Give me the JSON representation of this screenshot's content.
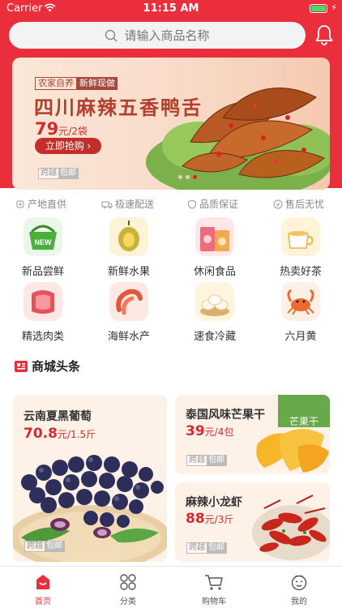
{
  "status_bar": {
    "carrier": "Carrier",
    "time": "11:15 AM"
  },
  "search": {
    "placeholder": "请输入商品名称"
  },
  "banner": {
    "tag1": "农家自养",
    "tag2": "新鲜现做",
    "title": "四川麻辣五香鸭舌",
    "price": "79",
    "price_unit": "元/2袋",
    "buy_button": "立即抢购 ›",
    "badge_a": "跨越",
    "badge_b": "包邮",
    "page_count": 3,
    "active_page": 3
  },
  "features": [
    "产地直供",
    "极速配送",
    "品质保证",
    "售后无忧"
  ],
  "categories": [
    {
      "label": "新品尝鲜",
      "icon": "new-basket-icon"
    },
    {
      "label": "新鲜水果",
      "icon": "durian-icon"
    },
    {
      "label": "休闲食品",
      "icon": "snacks-icon"
    },
    {
      "label": "热卖好茶",
      "icon": "tea-cup-icon"
    },
    {
      "label": "精选肉类",
      "icon": "meat-icon"
    },
    {
      "label": "海鲜水产",
      "icon": "shrimp-icon"
    },
    {
      "label": "速食冷藏",
      "icon": "dumpling-icon"
    },
    {
      "label": "六月黄",
      "icon": "crab-icon"
    }
  ],
  "news": {
    "title": "商城头条"
  },
  "products": [
    {
      "name": "云南夏黑葡萄",
      "price": "70.8",
      "unit": "元/1.5斤",
      "badge_a": "跨越",
      "badge_b": "包邮"
    },
    {
      "name": "泰国风味芒果干",
      "price": "39",
      "unit": "元/4包",
      "badge_a": "跨越",
      "badge_b": "包邮",
      "package_text": "芒果干"
    },
    {
      "name": "麻辣小龙虾",
      "price": "88",
      "unit": "元/3斤",
      "badge_a": "跨越",
      "badge_b": "包邮"
    }
  ],
  "tabs": [
    {
      "label": "首页",
      "active": true
    },
    {
      "label": "分类",
      "active": false
    },
    {
      "label": "购物车",
      "active": false
    },
    {
      "label": "我的",
      "active": false
    }
  ],
  "colors": {
    "brand_red": "#ea2e3c",
    "price_red": "#d32c2c"
  }
}
